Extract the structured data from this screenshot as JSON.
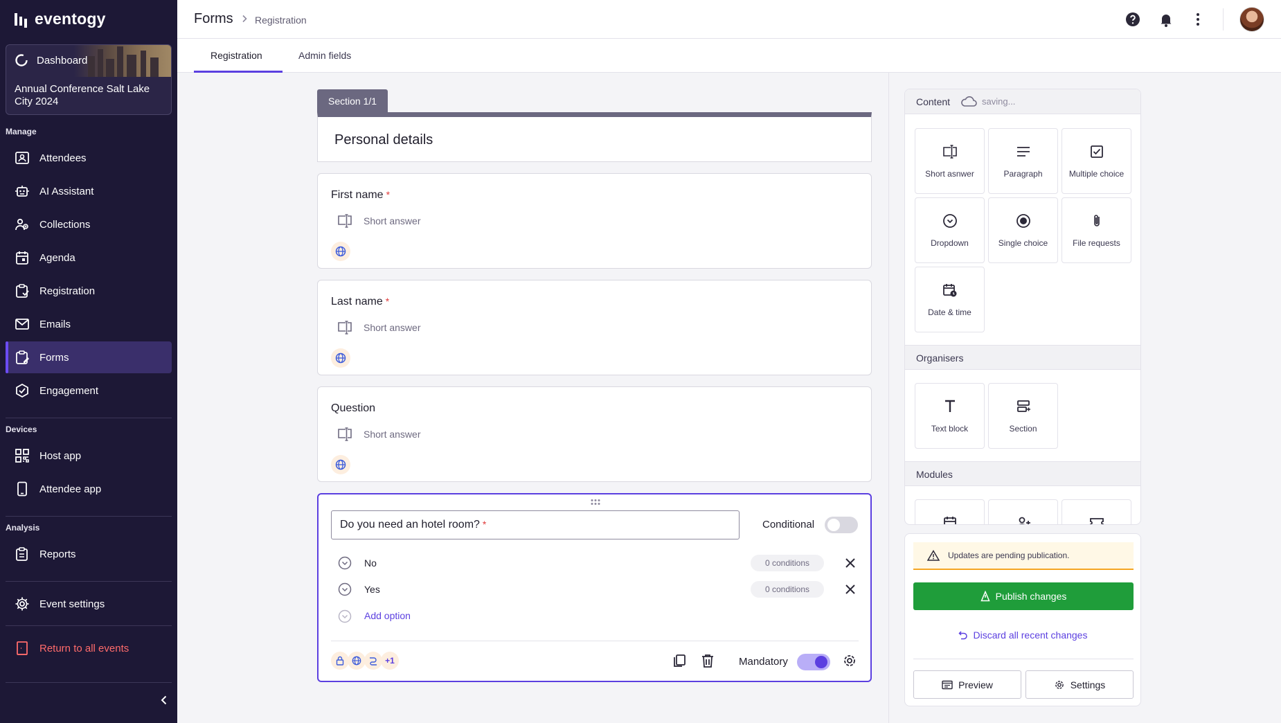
{
  "app": {
    "name": "eventogy"
  },
  "sidebar": {
    "dashboard_label": "Dashboard",
    "event_name": "Annual Conference Salt Lake City 2024",
    "sections": {
      "manage": "Manage",
      "devices": "Devices",
      "analysis": "Analysis"
    },
    "items": [
      {
        "label": "Attendees",
        "icon": "attendees-icon"
      },
      {
        "label": "AI Assistant",
        "icon": "robot-icon"
      },
      {
        "label": "Collections",
        "icon": "collections-icon"
      },
      {
        "label": "Agenda",
        "icon": "calendar-icon"
      },
      {
        "label": "Registration",
        "icon": "clipboard-icon"
      },
      {
        "label": "Emails",
        "icon": "mail-icon"
      },
      {
        "label": "Forms",
        "icon": "forms-icon",
        "active": true
      },
      {
        "label": "Engagement",
        "icon": "engagement-icon"
      },
      {
        "label": "Host app",
        "icon": "qr-icon"
      },
      {
        "label": "Attendee app",
        "icon": "phone-icon"
      },
      {
        "label": "Reports",
        "icon": "reports-icon"
      },
      {
        "label": "Event settings",
        "icon": "gear-icon"
      },
      {
        "label": "Return to all events",
        "icon": "exit-icon"
      }
    ]
  },
  "header": {
    "title": "Forms",
    "breadcrumb": "Registration"
  },
  "tabs": [
    {
      "label": "Registration"
    },
    {
      "label": "Admin fields"
    }
  ],
  "form": {
    "section_tab": "Section 1/1",
    "section_title": "Personal details",
    "questions": [
      {
        "title": "First name",
        "type": "Short answer",
        "required": "*"
      },
      {
        "title": "Last name",
        "type": "Short answer",
        "required": "*"
      },
      {
        "title": "Question",
        "type": "Short answer"
      }
    ],
    "active_question": {
      "title": "Do you need an hotel room?",
      "required": "*",
      "conditional_label": "Conditional",
      "options": [
        {
          "label": "No",
          "conditions": "0 conditions"
        },
        {
          "label": "Yes",
          "conditions": "0 conditions"
        }
      ],
      "add_option": "Add option",
      "more_badge": "+1",
      "mandatory_label": "Mandatory"
    }
  },
  "panel": {
    "content_title": "Content",
    "saving": "saving...",
    "content_tiles": [
      {
        "label": "Short asnwer",
        "icon": "short-answer-icon"
      },
      {
        "label": "Paragraph",
        "icon": "paragraph-icon"
      },
      {
        "label": "Multiple choice",
        "icon": "checkbox-icon"
      },
      {
        "label": "Dropdown",
        "icon": "dropdown-icon"
      },
      {
        "label": "Single choice",
        "icon": "radio-icon"
      },
      {
        "label": "File requests",
        "icon": "paperclip-icon"
      },
      {
        "label": "Date & time",
        "icon": "date-time-icon"
      }
    ],
    "organisers_title": "Organisers",
    "organiser_tiles": [
      {
        "label": "Text block",
        "icon": "text-block-icon"
      },
      {
        "label": "Section",
        "icon": "section-icon"
      }
    ],
    "modules_title": "Modules"
  },
  "publish": {
    "warning": "Updates are pending publication.",
    "publish_label": "Publish changes",
    "discard_label": "Discard all recent changes",
    "preview_label": "Preview",
    "settings_label": "Settings"
  },
  "colors": {
    "accent": "#5b3fe0",
    "sidebar": "#1d1836",
    "publish": "#1f9d3a",
    "danger": "#ff6b6b"
  }
}
